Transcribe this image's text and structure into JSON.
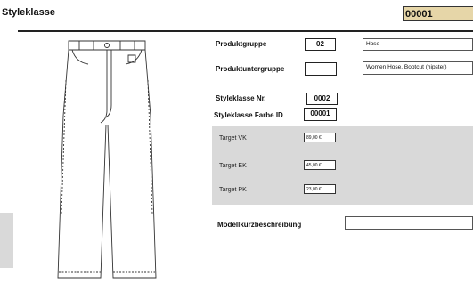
{
  "header": {
    "title": "Styleklasse",
    "id_value": "00001"
  },
  "fields": {
    "produktgruppe": {
      "label": "Produktgruppe",
      "value": "02",
      "description": "Hose"
    },
    "produktuntergruppe": {
      "label": "Produktuntergruppe",
      "value": "",
      "description": "Women Hose, Bootcut (hipster)"
    },
    "styleklasse_nr": {
      "label": "Styleklasse Nr.",
      "value": "0002"
    },
    "styleklasse_farbe_id": {
      "label": "Styleklasse Farbe ID",
      "value": "00001"
    },
    "modellkurzbeschreibung": {
      "label": "Modellkurzbeschreibung",
      "value": ""
    }
  },
  "targets": [
    {
      "label": "Target VK",
      "value": "89,00 €"
    },
    {
      "label": "Target EK",
      "value": "45,00 €"
    },
    {
      "label": "Target PK",
      "value": "23,00 €"
    }
  ],
  "sketch": {
    "icon": "jeans-sketch-icon"
  }
}
